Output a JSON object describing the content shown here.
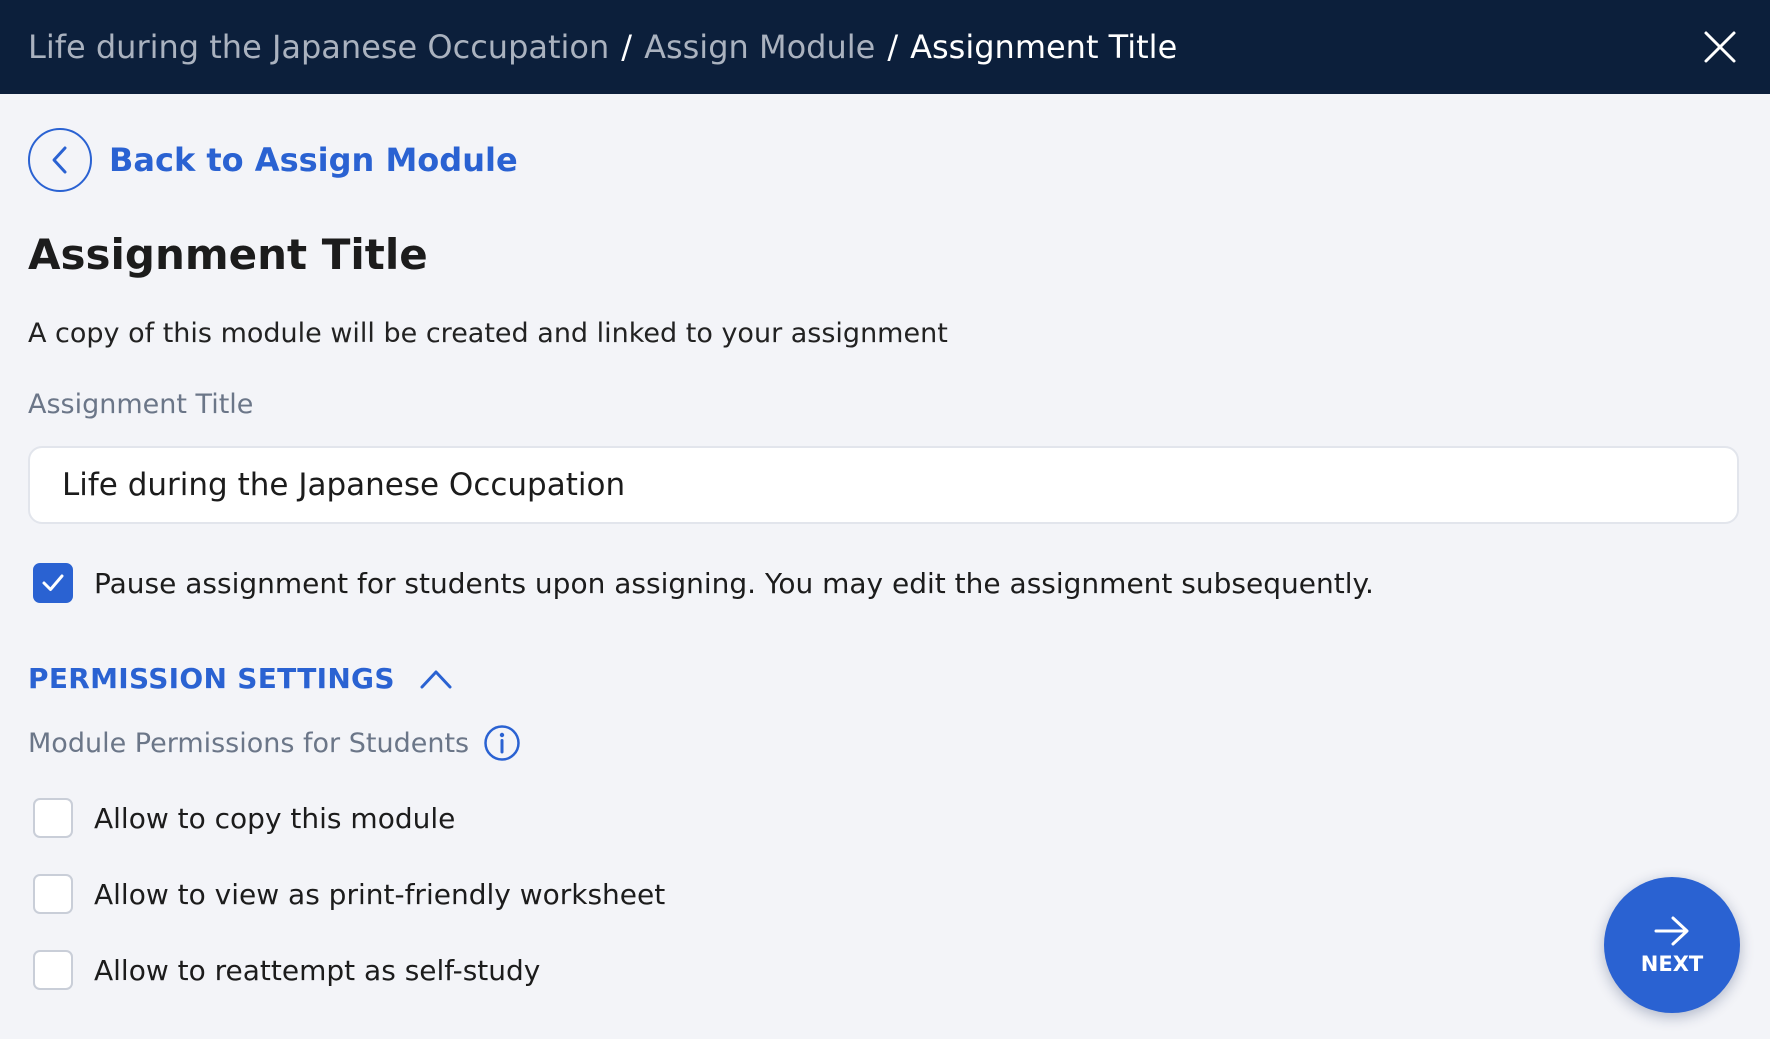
{
  "breadcrumb": {
    "items": [
      "Life during the Japanese Occupation",
      "Assign Module",
      "Assignment Title"
    ],
    "separator": "/"
  },
  "back_link": {
    "label": "Back to Assign Module"
  },
  "page": {
    "title": "Assignment Title",
    "subtitle": "A copy of this module will be created and linked to your assignment"
  },
  "assignment_title_field": {
    "label": "Assignment Title",
    "value": "Life during the Japanese Occupation"
  },
  "pause_option": {
    "label": "Pause assignment for students upon assigning. You may edit the assignment subsequently.",
    "checked": true
  },
  "permission_settings": {
    "title": "PERMISSION SETTINGS",
    "expanded": true,
    "subheading": "Module Permissions for Students",
    "options": [
      {
        "label": "Allow to copy this module",
        "checked": false
      },
      {
        "label": "Allow to view as print-friendly worksheet",
        "checked": false
      },
      {
        "label": "Allow to reattempt as self-study",
        "checked": false
      }
    ]
  },
  "next_button": {
    "label": "NEXT"
  },
  "icons": {
    "close": "close-icon",
    "back": "chevron-left-icon",
    "check": "checkmark-icon",
    "collapse": "chevron-up-icon",
    "info": "info-icon",
    "next": "arrow-right-icon"
  },
  "colors": {
    "header_bg": "#0c1f3b",
    "accent": "#2a62d2",
    "page_bg": "#f3f4f8",
    "muted_text": "#6b7688"
  }
}
